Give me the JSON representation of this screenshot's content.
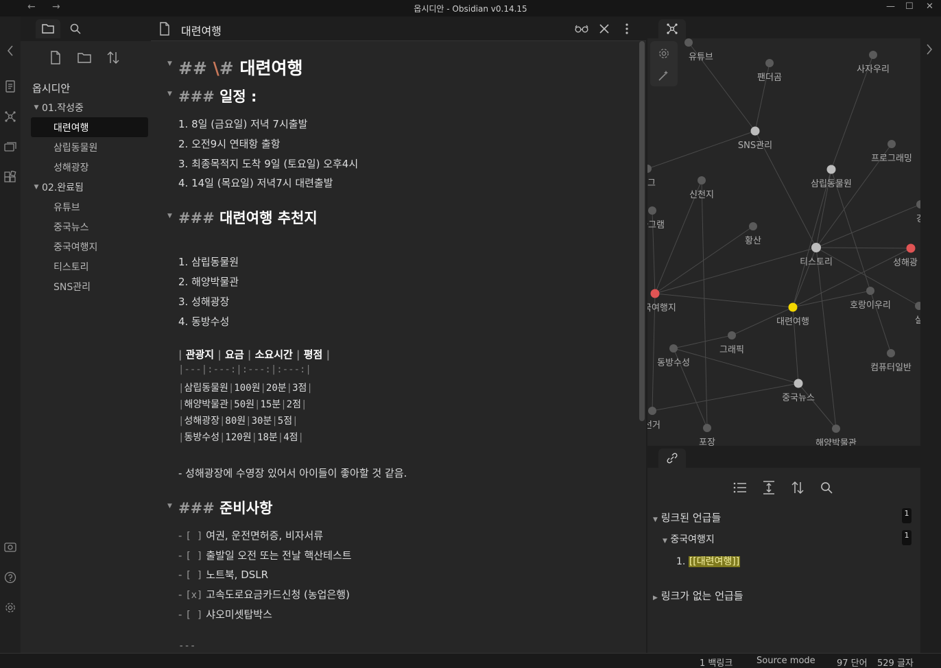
{
  "window": {
    "title": "옵시디안 - Obsidian v0.14.15",
    "back_glyph": "←",
    "forward_glyph": "→",
    "minimize_glyph": "—",
    "maximize_glyph": "☐",
    "close_glyph": "✕"
  },
  "sidebar": {
    "vault_name": "옵시디안",
    "tree": [
      {
        "type": "folder",
        "label": "01.작성중"
      },
      {
        "type": "file",
        "label": "대련여행",
        "active": true
      },
      {
        "type": "file",
        "label": "삼립동물원"
      },
      {
        "type": "file",
        "label": "성해광장"
      },
      {
        "type": "folder",
        "label": "02.완료됨"
      },
      {
        "type": "file",
        "label": "유튜브"
      },
      {
        "type": "file",
        "label": "중국뉴스"
      },
      {
        "type": "file",
        "label": "중국여행지"
      },
      {
        "type": "file",
        "label": "티스토리"
      },
      {
        "type": "file",
        "label": "SNS관리"
      }
    ]
  },
  "editor": {
    "tab_title": "대련여행",
    "h2": {
      "marker": "##",
      "escape": "\\",
      "hash": "#",
      "text": "대련여행"
    },
    "sections": {
      "schedule": {
        "marker": "###",
        "title": "일정 :"
      },
      "recommend": {
        "marker": "###",
        "title": "대련여행 추천지"
      },
      "prepare": {
        "marker": "###",
        "title": "준비사항"
      }
    },
    "schedule_items": [
      "1. 8일 (금요일) 저녁 7시출발",
      "2. 오전9시 연태항 출항",
      "3. 최종목적지 도착 9일 (토요일) 오후4시",
      "4. 14일 (목요일) 저녁7시 대련출발"
    ],
    "recommend_items": [
      "1. 삼립동물원",
      "2. 해양박물관",
      "3. 성해광장",
      "4. 동방수성"
    ],
    "table": {
      "headers": [
        "관광지",
        "요금",
        "소요시간",
        "평점"
      ],
      "separator": "|---|:---:|:---:|:---:|",
      "rows": [
        [
          "삼립동물원",
          "100원",
          "20분",
          "3점"
        ],
        [
          "해양박물관",
          "50원",
          "15분",
          "2점"
        ],
        [
          "성해광장",
          "80원",
          "30분",
          "5점"
        ],
        [
          "동방수성",
          "120원",
          "18분",
          "4점"
        ]
      ]
    },
    "note": "- 성해광장에 수영장 있어서 아이들이 좋아할 것 같음.",
    "checklist": [
      {
        "box": "[ ]",
        "text": "여권, 운전면허증, 비자서류"
      },
      {
        "box": "[ ]",
        "text": "출발일 오전 또는 전날 핵산테스트"
      },
      {
        "box": "[ ]",
        "text": "노트북, DSLR"
      },
      {
        "box": "[x]",
        "text": "고속도로요금카드신청 (농업은행)"
      },
      {
        "box": "[ ]",
        "text": "샤오미셋탑박스"
      }
    ],
    "hr": "---"
  },
  "graph": {
    "nodes": [
      {
        "id": "youtube",
        "label": "유튜브",
        "color": "#5a5a5a"
      },
      {
        "id": "panda",
        "label": "팬더곰",
        "color": "#5a5a5a"
      },
      {
        "id": "lion",
        "label": "사자우리",
        "color": "#5a5a5a"
      },
      {
        "id": "sns",
        "label": "SNS관리",
        "color": "#bdbdbd"
      },
      {
        "id": "prog",
        "label": "프로그래밍",
        "color": "#5a5a5a"
      },
      {
        "id": "g",
        "label": "그",
        "color": "#5a5a5a"
      },
      {
        "id": "zoo",
        "label": "삼립동물원",
        "color": "#bdbdbd"
      },
      {
        "id": "shinchon",
        "label": "신천지",
        "color": "#5a5a5a"
      },
      {
        "id": "tagram",
        "label": "타그램",
        "color": "#5a5a5a"
      },
      {
        "id": "hwangsan",
        "label": "황산",
        "color": "#5a5a5a"
      },
      {
        "id": "tistory",
        "label": "티스토리",
        "color": "#bdbdbd"
      },
      {
        "id": "sunghae",
        "label": "성해광",
        "color": "#e05454"
      },
      {
        "id": "chinatrip",
        "label": "국여행지",
        "color": "#e05454"
      },
      {
        "id": "dalian",
        "label": "대련여행",
        "color": "#f2d600"
      },
      {
        "id": "tiger",
        "label": "호랑이우리",
        "color": "#5a5a5a"
      },
      {
        "id": "graphic",
        "label": "그래픽",
        "color": "#5a5a5a"
      },
      {
        "id": "dongbang",
        "label": "동방수성",
        "color": "#5a5a5a"
      },
      {
        "id": "computer",
        "label": "컴퓨터일반",
        "color": "#5a5a5a"
      },
      {
        "id": "chinanews",
        "label": "중국뉴스",
        "color": "#bdbdbd"
      },
      {
        "id": "election",
        "label": "선거",
        "color": "#5a5a5a"
      },
      {
        "id": "pojang",
        "label": "포장",
        "color": "#5a5a5a"
      },
      {
        "id": "museum",
        "label": "해양박물관",
        "color": "#5a5a5a"
      },
      {
        "id": "sal",
        "label": "살",
        "color": "#5a5a5a"
      },
      {
        "id": "gang",
        "label": "강",
        "color": "#5a5a5a"
      }
    ],
    "edges": [
      [
        "youtube",
        "sns"
      ],
      [
        "panda",
        "sns"
      ],
      [
        "lion",
        "zoo"
      ],
      [
        "sns",
        "tistory"
      ],
      [
        "sns",
        "g"
      ],
      [
        "zoo",
        "tistory"
      ],
      [
        "prog",
        "tistory"
      ],
      [
        "tistory",
        "chinatrip"
      ],
      [
        "tistory",
        "sunghae"
      ],
      [
        "tistory",
        "dalian"
      ],
      [
        "tistory",
        "gang"
      ],
      [
        "chinatrip",
        "dalian"
      ],
      [
        "chinatrip",
        "shinchon"
      ],
      [
        "chinatrip",
        "hwangsan"
      ],
      [
        "chinatrip",
        "election"
      ],
      [
        "chinatrip",
        "tagram"
      ],
      [
        "dalian",
        "chinanews"
      ],
      [
        "dalian",
        "zoo"
      ],
      [
        "dalian",
        "tiger"
      ],
      [
        "dalian",
        "graphic"
      ],
      [
        "dalian",
        "sunghae"
      ],
      [
        "tiger",
        "computer"
      ],
      [
        "tistory",
        "sal"
      ],
      [
        "chinanews",
        "election"
      ],
      [
        "chinanews",
        "museum"
      ],
      [
        "dongbang",
        "pojang"
      ],
      [
        "dongbang",
        "chinanews"
      ],
      [
        "zoo",
        "tiger"
      ],
      [
        "graphic",
        "dongbang"
      ],
      [
        "museum",
        "tistory"
      ],
      [
        "shinchon",
        "pojang"
      ]
    ]
  },
  "backlinks": {
    "linked_label": "링크된 언급들",
    "linked_count": "1",
    "source_file": "중국여행지",
    "source_count": "1",
    "match_prefix": "1.",
    "match_text": "[[대련여행]]",
    "unlinked_label": "링크가 없는 언급들"
  },
  "status": {
    "backlinks": "1 백링크",
    "mode": "Source mode",
    "words": "97 단어",
    "chars": "529 글자"
  }
}
